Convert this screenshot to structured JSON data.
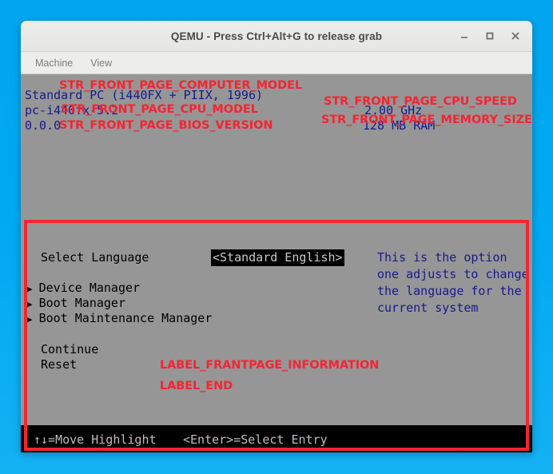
{
  "window": {
    "title": "QEMU - Press Ctrl+Alt+G to release grab",
    "buttons": {
      "minimize": "minimize-button",
      "maximize": "maximize-button",
      "close": "close-button"
    }
  },
  "menubar": {
    "items": [
      {
        "label": "Machine"
      },
      {
        "label": "View"
      }
    ]
  },
  "bios": {
    "header": {
      "computer_model": "Standard PC (i440FX + PIIX, 1996)",
      "cpu_model": "pc-i440fx-5.2",
      "bios_version": "0.0.0",
      "cpu_speed": "2.00 GHz",
      "memory_size": "128 MB RAM"
    },
    "annotations": {
      "computer_model": "STR_FRONT_PAGE_COMPUTER_MODEL",
      "cpu_model": "STR_FRONT_PAGE_CPU_MODEL",
      "bios_version": "STR_FRONT_PAGE_BIOS_VERSION",
      "cpu_speed": "STR_FRONT_PAGE_CPU_SPEED",
      "memory_size": "STR_FRONT_PAGE_MEMORY_SIZE",
      "frontpage_information": "LABEL_FRANTPAGE_INFORMATION",
      "label_end": "LABEL_END"
    },
    "body": {
      "select_language_label": "Select Language",
      "select_language_value": "<Standard English>",
      "submenus": [
        {
          "arrow": "triangle-right-icon",
          "label": "Device Manager"
        },
        {
          "arrow": "triangle-right-icon",
          "label": "Boot Manager"
        },
        {
          "arrow": "triangle-right-icon",
          "label": "Boot Maintenance Manager"
        }
      ],
      "actions": [
        {
          "label": "Continue"
        },
        {
          "label": "Reset"
        }
      ],
      "help_lines": [
        "This is the option",
        "one adjusts to change",
        "the language for the",
        "current system"
      ]
    },
    "footer": {
      "move_highlight": "↑↓=Move Highlight",
      "select_entry": "<Enter>=Select Entry"
    }
  },
  "colors": {
    "desktop": "#00a8f0",
    "bios_gray": "#969696",
    "bios_blue_text": "#161b8c",
    "annotation_red": "#f42532",
    "footer_text": "#bdbdbd",
    "black": "#000000"
  }
}
